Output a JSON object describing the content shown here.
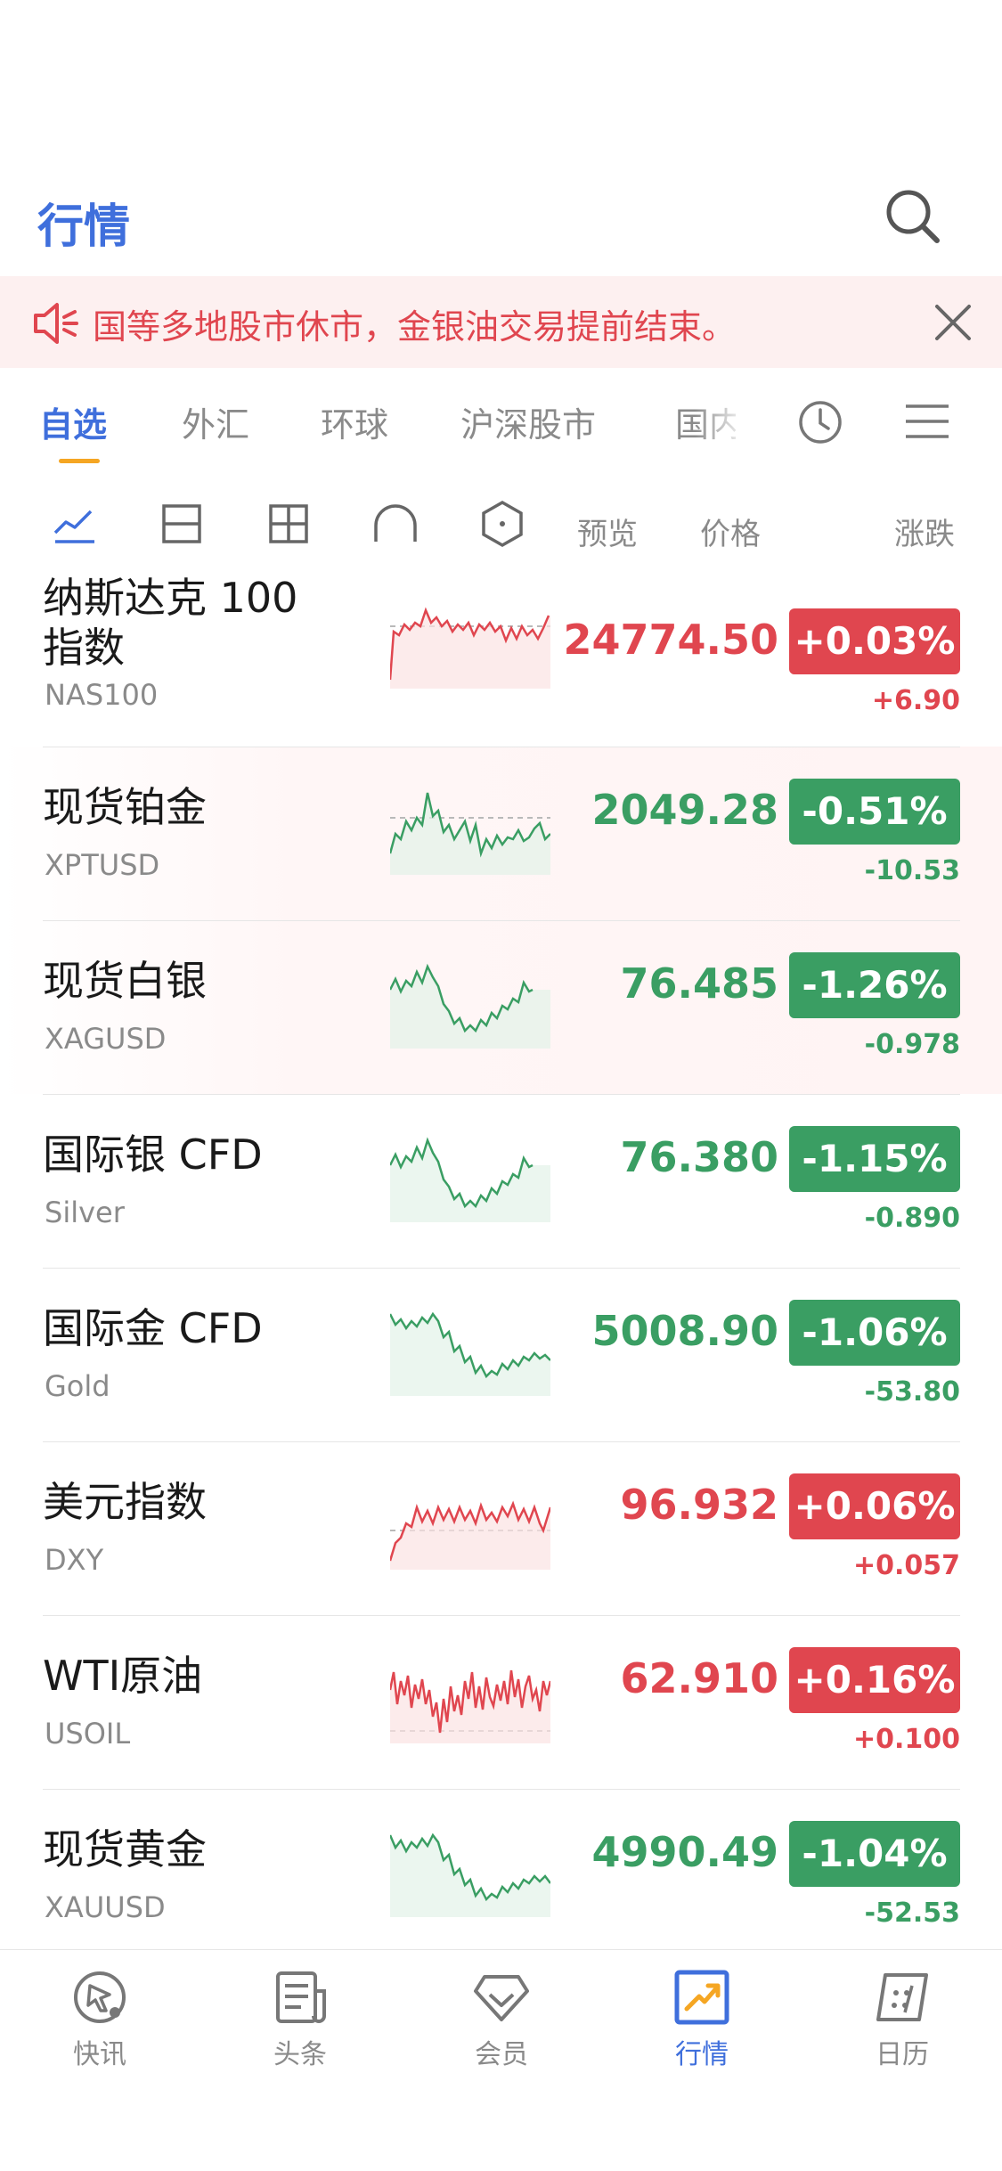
{
  "header": {
    "title": "行情"
  },
  "notice": {
    "text": "国等多地股市休市，金银油交易提前结束。"
  },
  "tabs": [
    {
      "label": "自选",
      "active": true
    },
    {
      "label": "外汇"
    },
    {
      "label": "环球"
    },
    {
      "label": "沪深股市"
    },
    {
      "label": "国内"
    }
  ],
  "toolbar": {
    "columns": {
      "preview": "预览",
      "price": "价格",
      "change": "涨跌"
    }
  },
  "quotes": [
    {
      "name": "纳斯达克 100",
      "name_line2": "指数",
      "symbol": "NAS100",
      "price": "24774.50",
      "pct": "+0.03%",
      "change": "+6.90",
      "trend": "up"
    },
    {
      "name": "现货铂金",
      "symbol": "XPTUSD",
      "price": "2049.28",
      "pct": "-0.51%",
      "change": "-10.53",
      "trend": "down"
    },
    {
      "name": "现货白银",
      "symbol": "XAGUSD",
      "price": "76.485",
      "pct": "-1.26%",
      "change": "-0.978",
      "trend": "down"
    },
    {
      "name": "国际银 CFD",
      "symbol": "Silver",
      "price": "76.380",
      "pct": "-1.15%",
      "change": "-0.890",
      "trend": "down"
    },
    {
      "name": "国际金 CFD",
      "symbol": "Gold",
      "price": "5008.90",
      "pct": "-1.06%",
      "change": "-53.80",
      "trend": "down"
    },
    {
      "name": "美元指数",
      "symbol": "DXY",
      "price": "96.932",
      "pct": "+0.06%",
      "change": "+0.057",
      "trend": "up"
    },
    {
      "name": "WTI原油",
      "symbol": "USOIL",
      "price": "62.910",
      "pct": "+0.16%",
      "change": "+0.100",
      "trend": "up"
    },
    {
      "name": "现货黄金",
      "symbol": "XAUUSD",
      "price": "4990.49",
      "pct": "-1.04%",
      "change": "-52.53",
      "trend": "down"
    }
  ],
  "bottom_nav": [
    {
      "label": "快讯",
      "icon": "flash-icon"
    },
    {
      "label": "头条",
      "icon": "news-icon"
    },
    {
      "label": "会员",
      "icon": "diamond-icon"
    },
    {
      "label": "行情",
      "icon": "market-chart-icon",
      "active": true
    },
    {
      "label": "日历",
      "icon": "calendar-icon"
    }
  ],
  "colors": {
    "accent": "#3f6fdc",
    "up": "#e0464f",
    "down": "#3a9e63",
    "tab_indicator": "#f5a623"
  }
}
